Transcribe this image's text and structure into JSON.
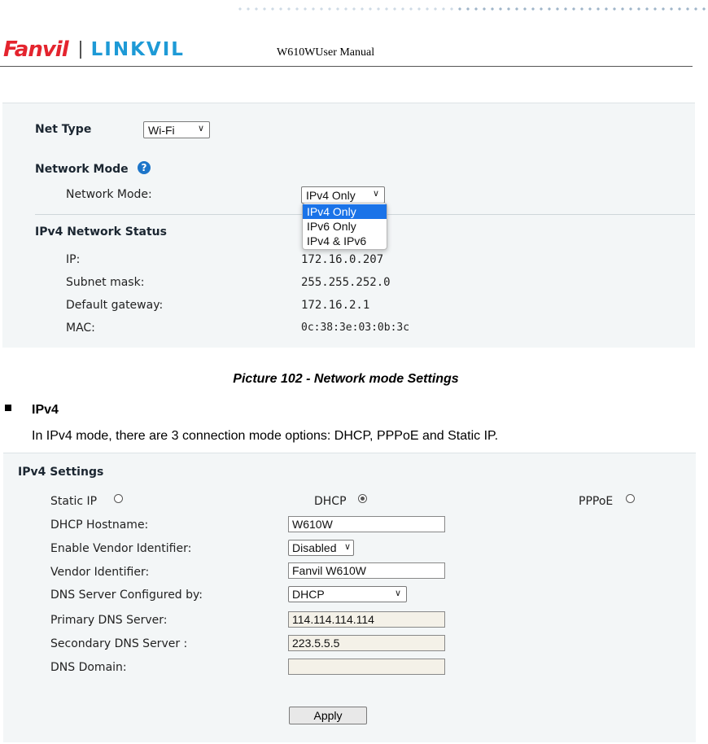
{
  "header": {
    "brand1": "Fanvil",
    "brand2": "LINKVIL",
    "manual_title": "W610WUser Manual"
  },
  "network_panel": {
    "net_type_label": "Net Type",
    "net_type_value": "Wi-Fi",
    "network_mode_heading": "Network Mode",
    "network_mode_label": "Network Mode:",
    "network_mode_value": "IPv4 Only",
    "dropdown_options": [
      "IPv4 Only",
      "IPv6 Only",
      "IPv4 & IPv6"
    ],
    "status_heading": "IPv4 Network Status",
    "status_rows": [
      {
        "label": "IP:",
        "value": "172.16.0.207"
      },
      {
        "label": "Subnet mask:",
        "value": "255.255.252.0"
      },
      {
        "label": "Default gateway:",
        "value": "172.16.2.1"
      },
      {
        "label": "MAC:",
        "value": "0c:38:3e:03:0b:3c"
      }
    ]
  },
  "caption": "Picture 102 - Network mode Settings",
  "section": {
    "heading": "IPv4",
    "text": "In IPv4 mode, there are 3 connection mode options: DHCP, PPPoE and Static IP."
  },
  "ipv4_panel": {
    "title": "IPv4 Settings",
    "modes": [
      {
        "label": "Static IP",
        "selected": false
      },
      {
        "label": "DHCP",
        "selected": true
      },
      {
        "label": "PPPoE",
        "selected": false
      }
    ],
    "dhcp_hostname_label": "DHCP Hostname:",
    "dhcp_hostname_value": "W610W",
    "vendor_id_enable_label": "Enable Vendor Identifier:",
    "vendor_id_enable_value": "Disabled",
    "vendor_id_label": "Vendor Identifier:",
    "vendor_id_value": "Fanvil W610W",
    "dns_config_label": "DNS Server Configured by:",
    "dns_config_value": "DHCP",
    "primary_dns_label": "Primary DNS Server:",
    "primary_dns_value": "114.114.114.114",
    "secondary_dns_label": "Secondary DNS Server :",
    "secondary_dns_value": "223.5.5.5",
    "dns_domain_label": "DNS Domain:",
    "dns_domain_value": "",
    "apply_label": "Apply"
  },
  "colors": {
    "brand_red": "#e4242e",
    "brand_blue": "#1e9ad6",
    "panel_bg": "#f3f6f7",
    "selected_option": "#1a73e8"
  }
}
